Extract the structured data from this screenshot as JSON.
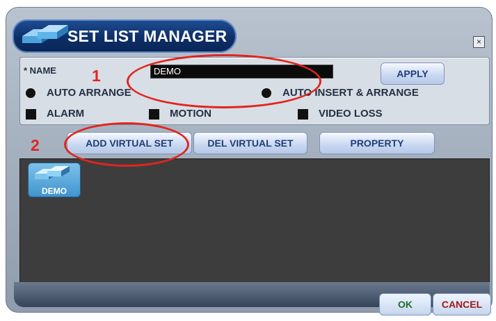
{
  "window": {
    "title": "SET LIST MANAGER",
    "close_glyph": "×",
    "title_icon": "set-icon"
  },
  "form": {
    "name_label": "* NAME",
    "name_value": "DEMO",
    "apply_label": "APPLY",
    "auto_arrange_label": "AUTO ARRANGE",
    "auto_insert_label": "AUTO INSERT & ARRANGE",
    "alarm_label": "ALARM",
    "motion_label": "MOTION",
    "video_loss_label": "VIDEO LOSS"
  },
  "toolbar": {
    "add_label": "ADD VIRTUAL SET",
    "del_label": "DEL VIRTUAL SET",
    "property_label": "PROPERTY"
  },
  "sets": [
    {
      "label": "DEMO",
      "icon": "virtual-set-icon"
    }
  ],
  "footer": {
    "ok_label": "OK",
    "cancel_label": "CANCEL"
  },
  "annotations": {
    "step1": "1",
    "step2": "2",
    "color": "#e0261f"
  }
}
